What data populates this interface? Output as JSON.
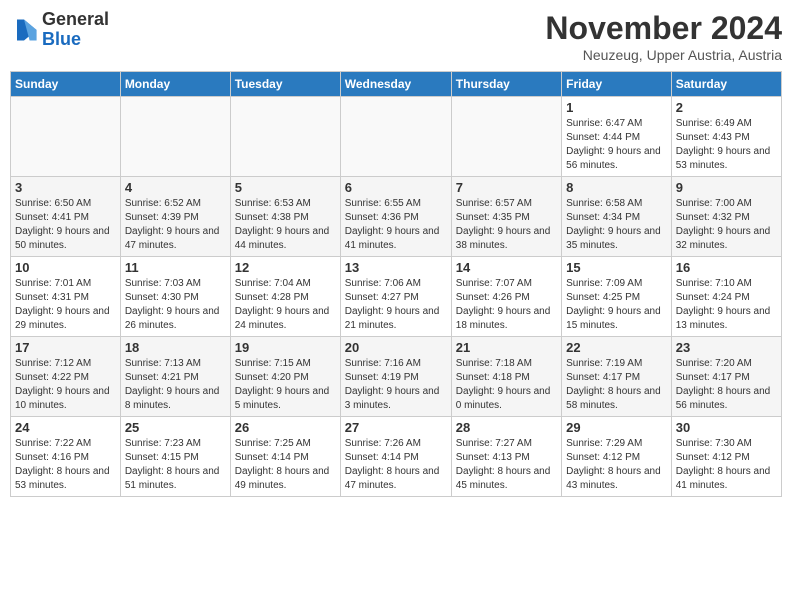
{
  "logo": {
    "general": "General",
    "blue": "Blue"
  },
  "title": "November 2024",
  "location": "Neuzeug, Upper Austria, Austria",
  "weekdays": [
    "Sunday",
    "Monday",
    "Tuesday",
    "Wednesday",
    "Thursday",
    "Friday",
    "Saturday"
  ],
  "weeks": [
    [
      {
        "day": "",
        "info": ""
      },
      {
        "day": "",
        "info": ""
      },
      {
        "day": "",
        "info": ""
      },
      {
        "day": "",
        "info": ""
      },
      {
        "day": "",
        "info": ""
      },
      {
        "day": "1",
        "info": "Sunrise: 6:47 AM\nSunset: 4:44 PM\nDaylight: 9 hours and 56 minutes."
      },
      {
        "day": "2",
        "info": "Sunrise: 6:49 AM\nSunset: 4:43 PM\nDaylight: 9 hours and 53 minutes."
      }
    ],
    [
      {
        "day": "3",
        "info": "Sunrise: 6:50 AM\nSunset: 4:41 PM\nDaylight: 9 hours and 50 minutes."
      },
      {
        "day": "4",
        "info": "Sunrise: 6:52 AM\nSunset: 4:39 PM\nDaylight: 9 hours and 47 minutes."
      },
      {
        "day": "5",
        "info": "Sunrise: 6:53 AM\nSunset: 4:38 PM\nDaylight: 9 hours and 44 minutes."
      },
      {
        "day": "6",
        "info": "Sunrise: 6:55 AM\nSunset: 4:36 PM\nDaylight: 9 hours and 41 minutes."
      },
      {
        "day": "7",
        "info": "Sunrise: 6:57 AM\nSunset: 4:35 PM\nDaylight: 9 hours and 38 minutes."
      },
      {
        "day": "8",
        "info": "Sunrise: 6:58 AM\nSunset: 4:34 PM\nDaylight: 9 hours and 35 minutes."
      },
      {
        "day": "9",
        "info": "Sunrise: 7:00 AM\nSunset: 4:32 PM\nDaylight: 9 hours and 32 minutes."
      }
    ],
    [
      {
        "day": "10",
        "info": "Sunrise: 7:01 AM\nSunset: 4:31 PM\nDaylight: 9 hours and 29 minutes."
      },
      {
        "day": "11",
        "info": "Sunrise: 7:03 AM\nSunset: 4:30 PM\nDaylight: 9 hours and 26 minutes."
      },
      {
        "day": "12",
        "info": "Sunrise: 7:04 AM\nSunset: 4:28 PM\nDaylight: 9 hours and 24 minutes."
      },
      {
        "day": "13",
        "info": "Sunrise: 7:06 AM\nSunset: 4:27 PM\nDaylight: 9 hours and 21 minutes."
      },
      {
        "day": "14",
        "info": "Sunrise: 7:07 AM\nSunset: 4:26 PM\nDaylight: 9 hours and 18 minutes."
      },
      {
        "day": "15",
        "info": "Sunrise: 7:09 AM\nSunset: 4:25 PM\nDaylight: 9 hours and 15 minutes."
      },
      {
        "day": "16",
        "info": "Sunrise: 7:10 AM\nSunset: 4:24 PM\nDaylight: 9 hours and 13 minutes."
      }
    ],
    [
      {
        "day": "17",
        "info": "Sunrise: 7:12 AM\nSunset: 4:22 PM\nDaylight: 9 hours and 10 minutes."
      },
      {
        "day": "18",
        "info": "Sunrise: 7:13 AM\nSunset: 4:21 PM\nDaylight: 9 hours and 8 minutes."
      },
      {
        "day": "19",
        "info": "Sunrise: 7:15 AM\nSunset: 4:20 PM\nDaylight: 9 hours and 5 minutes."
      },
      {
        "day": "20",
        "info": "Sunrise: 7:16 AM\nSunset: 4:19 PM\nDaylight: 9 hours and 3 minutes."
      },
      {
        "day": "21",
        "info": "Sunrise: 7:18 AM\nSunset: 4:18 PM\nDaylight: 9 hours and 0 minutes."
      },
      {
        "day": "22",
        "info": "Sunrise: 7:19 AM\nSunset: 4:17 PM\nDaylight: 8 hours and 58 minutes."
      },
      {
        "day": "23",
        "info": "Sunrise: 7:20 AM\nSunset: 4:17 PM\nDaylight: 8 hours and 56 minutes."
      }
    ],
    [
      {
        "day": "24",
        "info": "Sunrise: 7:22 AM\nSunset: 4:16 PM\nDaylight: 8 hours and 53 minutes."
      },
      {
        "day": "25",
        "info": "Sunrise: 7:23 AM\nSunset: 4:15 PM\nDaylight: 8 hours and 51 minutes."
      },
      {
        "day": "26",
        "info": "Sunrise: 7:25 AM\nSunset: 4:14 PM\nDaylight: 8 hours and 49 minutes."
      },
      {
        "day": "27",
        "info": "Sunrise: 7:26 AM\nSunset: 4:14 PM\nDaylight: 8 hours and 47 minutes."
      },
      {
        "day": "28",
        "info": "Sunrise: 7:27 AM\nSunset: 4:13 PM\nDaylight: 8 hours and 45 minutes."
      },
      {
        "day": "29",
        "info": "Sunrise: 7:29 AM\nSunset: 4:12 PM\nDaylight: 8 hours and 43 minutes."
      },
      {
        "day": "30",
        "info": "Sunrise: 7:30 AM\nSunset: 4:12 PM\nDaylight: 8 hours and 41 minutes."
      }
    ]
  ]
}
